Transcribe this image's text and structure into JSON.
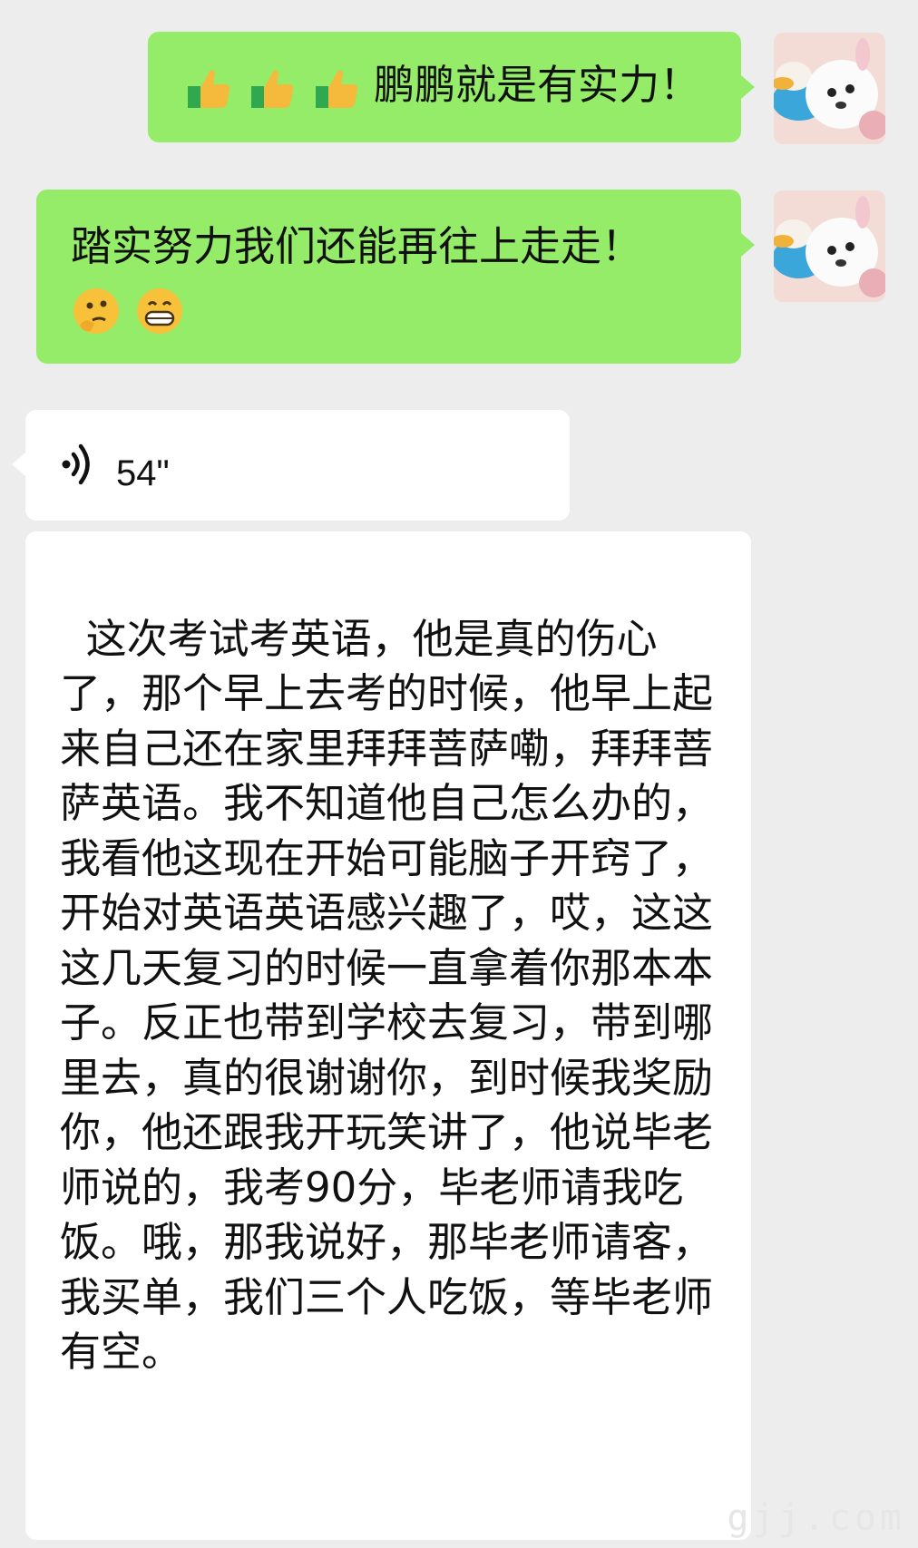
{
  "messages": [
    {
      "direction": "sent",
      "emojis_before": [
        "thumbs-up",
        "thumbs-up",
        "thumbs-up"
      ],
      "text": "鹏鹏就是有实力！"
    },
    {
      "direction": "sent",
      "text": "踏实努力我们还能再往上走走！",
      "emojis_after": [
        "thinking-face",
        "grinning-face"
      ]
    },
    {
      "direction": "received",
      "type": "voice",
      "duration": "54\""
    },
    {
      "direction": "received",
      "type": "voice-transcript",
      "text": "这次考试考英语，他是真的伤心了，那个早上去考的时候，他早上起来自己还在家里拜拜菩萨嘞，拜拜菩萨英语。我不知道他自己怎么办的，我看他这现在开始可能脑子开窍了，开始对英语英语感兴趣了，哎，这这这几天复习的时候一直拿着你那本本子。反正也带到学校去复习，带到哪里去，真的很谢谢你，到时候我奖励你，他还跟我开玩笑讲了，他说毕老师说的，我考90分，毕老师请我吃饭。哦，那我说好，那毕老师请客，我买单，我们三个人吃饭，等毕老师有空。"
    }
  ],
  "watermark": "gjj.com",
  "colors": {
    "background": "#ededed",
    "sent_bubble": "#95ec69",
    "received_bubble": "#ffffff"
  }
}
